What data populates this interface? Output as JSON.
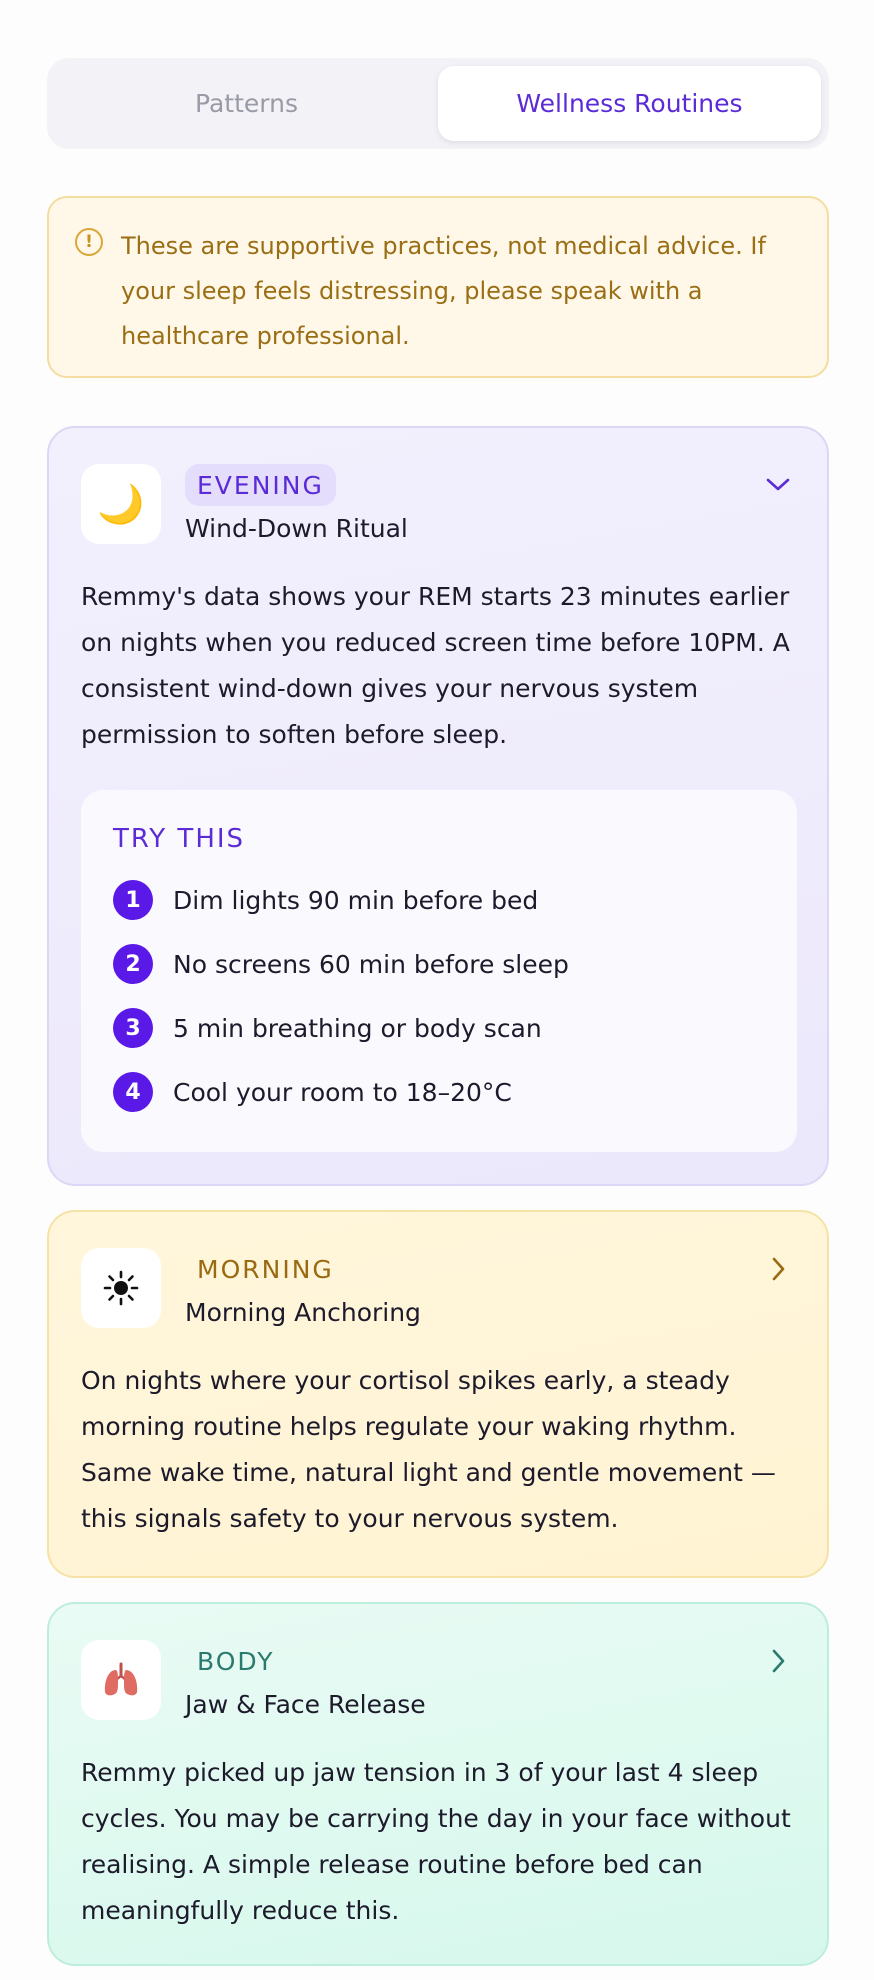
{
  "tabs": [
    {
      "label": "Patterns",
      "active": false
    },
    {
      "label": "Wellness Routines",
      "active": true
    }
  ],
  "notice": {
    "text": "These are supportive practices, not medical advice. If your sleep feels distressing, please speak with a healthcare professional.",
    "icon": "warning-circle-icon"
  },
  "routines": [
    {
      "tag": "EVENING",
      "title": "Wind-Down Ritual",
      "icon": "crescent-moon-icon",
      "icon_glyph": "🌙",
      "expanded": true,
      "description": "Remmy's data shows your REM starts 23 minutes earlier on nights when you reduced screen time before 10PM. A consistent wind-down gives your nervous system permission to soften before sleep.",
      "try_this": {
        "heading": "TRY THIS",
        "steps": [
          {
            "num": "1",
            "label": "Dim lights 90 min before bed"
          },
          {
            "num": "2",
            "label": "No screens 60 min before sleep"
          },
          {
            "num": "3",
            "label": "5 min breathing or body scan"
          },
          {
            "num": "4",
            "label": "Cool your room to 18–20°C"
          }
        ]
      },
      "accent": "#5b2bd6"
    },
    {
      "tag": "MORNING",
      "title": "Morning Anchoring",
      "icon": "sun-icon",
      "icon_glyph": "☀",
      "expanded": false,
      "description": "On nights where your cortisol spikes early, a steady morning routine helps regulate your waking rhythm. Same wake time, natural light and gentle movement — this signals safety to your nervous system.",
      "accent": "#9a6a12"
    },
    {
      "tag": "BODY",
      "title": "Jaw & Face Release",
      "icon": "lungs-icon",
      "icon_glyph": "🫁",
      "expanded": false,
      "description": "Remmy picked up jaw tension in 3 of your last 4 sleep cycles. You may be carrying the day in your face without realising. A simple release routine before bed can meaningfully reduce this.",
      "accent": "#2a7a6e"
    }
  ]
}
